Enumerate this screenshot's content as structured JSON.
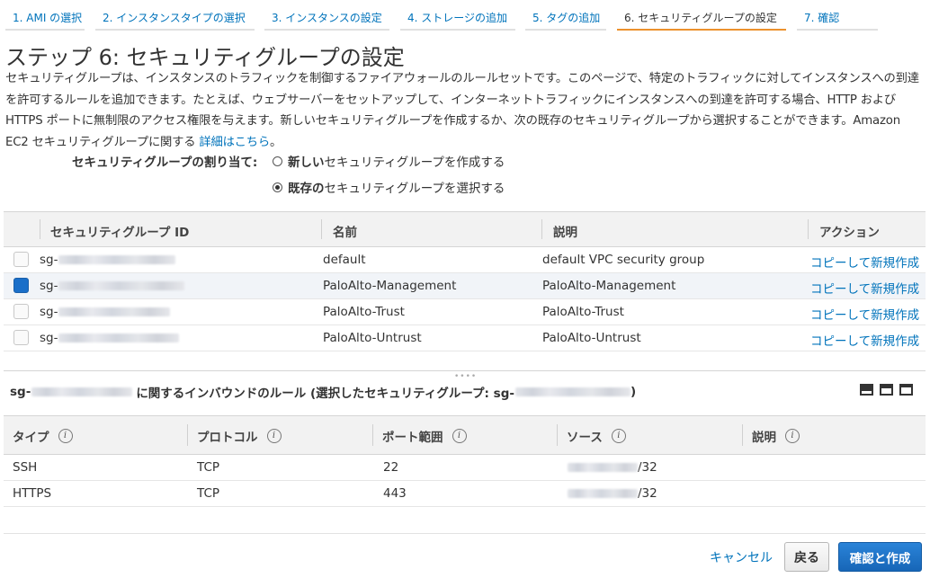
{
  "steps": [
    {
      "label": "1. AMI の選択"
    },
    {
      "label": "2. インスタンスタイプの選択"
    },
    {
      "label": "3. インスタンスの設定"
    },
    {
      "label": "4. ストレージの追加"
    },
    {
      "label": "5. タグの追加"
    },
    {
      "label": "6. セキュリティグループの設定",
      "active": true
    },
    {
      "label": "7. 確認"
    }
  ],
  "page": {
    "title": "ステップ 6: セキュリティグループの設定",
    "description": "セキュリティグループは、インスタンスのトラフィックを制御するファイアウォールのルールセットです。このページで、特定のトラフィックに対してインスタンスへの到達を許可するルールを追加できます。たとえば、ウェブサーバーをセットアップして、インターネットトラフィックにインスタンスへの到達を許可する場合、HTTP および HTTPS ポートに無制限のアクセス権限を与えます。新しいセキュリティグループを作成するか、次の既存のセキュリティグループから選択することができます。Amazon EC2 セキュリティグループに関する",
    "learn_more": "詳細はこちら",
    "period": "。"
  },
  "assignment": {
    "label": "セキュリティグループの割り当て:",
    "new_bold": "新しい",
    "new_rest": "セキュリティグループを作成する",
    "existing_bold": "既存の",
    "existing_rest": "セキュリティグループを選択する",
    "selected": "existing"
  },
  "sg_table": {
    "headers": {
      "id": "セキュリティグループ ID",
      "name": "名前",
      "description": "説明",
      "actions": "アクション"
    },
    "rows": [
      {
        "id_prefix": "sg-",
        "name": "default",
        "description": "default VPC security group",
        "action": "コピーして新規作成",
        "checked": false
      },
      {
        "id_prefix": "sg-",
        "name": "PaloAlto-Management",
        "description": "PaloAlto-Management",
        "action": "コピーして新規作成",
        "checked": true
      },
      {
        "id_prefix": "sg-",
        "name": "PaloAlto-Trust",
        "description": "PaloAlto-Trust",
        "action": "コピーして新規作成",
        "checked": false
      },
      {
        "id_prefix": "sg-",
        "name": "PaloAlto-Untrust",
        "description": "PaloAlto-Untrust",
        "action": "コピーして新規作成",
        "checked": false
      }
    ]
  },
  "inbound": {
    "sg_prefix": "sg-",
    "title_middle": "に関するインバウンドのルール (選択したセキュリティグループ: sg-",
    "title_end": ")",
    "headers": {
      "type": "タイプ",
      "protocol": "プロトコル",
      "port": "ポート範囲",
      "source": "ソース",
      "description": "説明"
    },
    "rows": [
      {
        "type": "SSH",
        "protocol": "TCP",
        "port": "22",
        "source_suffix": "/32"
      },
      {
        "type": "HTTPS",
        "protocol": "TCP",
        "port": "443",
        "source_suffix": "/32"
      }
    ]
  },
  "footer": {
    "cancel": "キャンセル",
    "back": "戻る",
    "launch": "確認と作成"
  }
}
